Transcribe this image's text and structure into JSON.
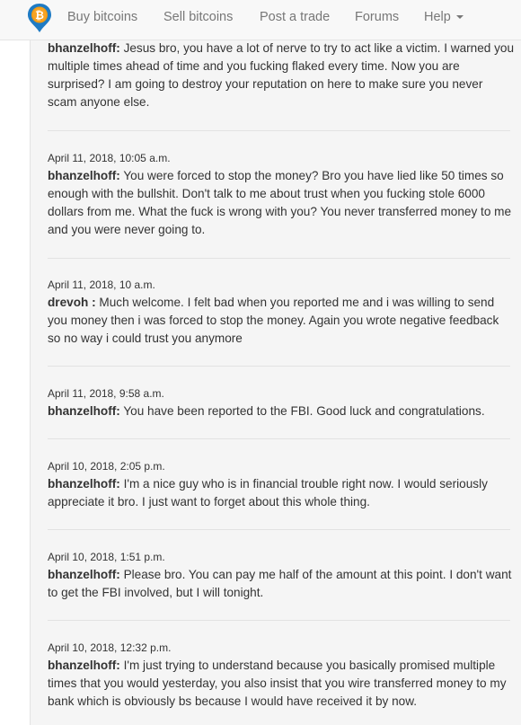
{
  "nav": {
    "items": [
      {
        "label": "Buy bitcoins"
      },
      {
        "label": "Sell bitcoins"
      },
      {
        "label": "Post a trade"
      },
      {
        "label": "Forums"
      },
      {
        "label": "Help"
      }
    ]
  },
  "messages": [
    {
      "date": "",
      "author": "bhanzelhoff:",
      "text": "Jesus bro, you have a lot of nerve to try to act like a victim. I warned you multiple times ahead of time and you fucking flaked every time. Now you are surprised? I am going to destroy your reputation on here to make sure you never scam anyone else."
    },
    {
      "date": "April 11, 2018, 10:05 a.m.",
      "author": "bhanzelhoff:",
      "text": "You were forced to stop the money? Bro you have lied like 50 times so enough with the bullshit. Don't talk to me about trust when you fucking stole 6000 dollars from me. What the fuck is wrong with you? You never transferred money to me and you were never going to."
    },
    {
      "date": "April 11, 2018, 10 a.m.",
      "author": "drevoh :",
      "text": "Much welcome. I felt bad when you reported me and i was willing to send you money then i was forced to stop the money. Again you wrote negative feedback so no way i could trust you anymore"
    },
    {
      "date": "April 11, 2018, 9:58 a.m.",
      "author": "bhanzelhoff:",
      "text": "You have been reported to the FBI. Good luck and congratulations."
    },
    {
      "date": "April 10, 2018, 2:05 p.m.",
      "author": "bhanzelhoff:",
      "text": "I'm a nice guy who is in financial trouble right now. I would seriously appreciate it bro. I just want to forget about this whole thing."
    },
    {
      "date": "April 10, 2018, 1:51 p.m.",
      "author": "bhanzelhoff:",
      "text": "Please bro. You can pay me half of the amount at this point. I don't want to get the FBI involved, but I will tonight."
    },
    {
      "date": "April 10, 2018, 12:32 p.m.",
      "author": "bhanzelhoff:",
      "text": "I'm just trying to understand because you basically promised multiple times that you would yesterday, you also insist that you wire transferred money to my bank which is obviously bs because I would have received it by now."
    }
  ]
}
